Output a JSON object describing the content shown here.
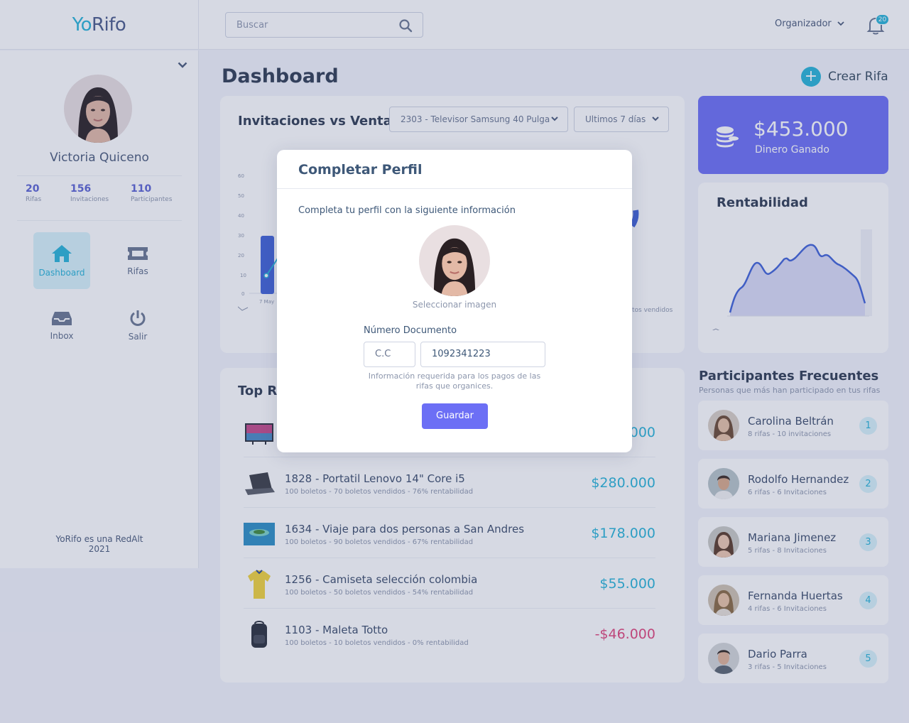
{
  "brand": {
    "logo_yo": "Yo",
    "logo_rifo": "Rifo"
  },
  "search": {
    "placeholder": "Buscar"
  },
  "header": {
    "role": "Organizador",
    "notifications": "20"
  },
  "user": {
    "name": "Victoria Quiceno",
    "stats": [
      {
        "value": "20",
        "label": "Rifas"
      },
      {
        "value": "156",
        "label": "Invitaciones"
      },
      {
        "value": "110",
        "label": "Participantes"
      }
    ]
  },
  "nav": {
    "dashboard": "Dashboard",
    "rifas": "Rifas",
    "inbox": "Inbox",
    "salir": "Salir"
  },
  "footer": {
    "line1": "YoRifo es una RedAlt",
    "line2": "2021"
  },
  "main": {
    "title": "Dashboard",
    "create_label": "Crear Rifa",
    "chart_card": {
      "title": "Invitaciones vs Ventas",
      "raffle_select": "2303 - Televisor Samsung 40 Pulga",
      "period_select": "Ultimos 7 días",
      "bar_label": "7 May",
      "side_label": "tos vendidos"
    },
    "earnings": {
      "amount": "$453.000",
      "label": "Dinero Ganado"
    },
    "rentabilidad": {
      "title": "Rentabilidad"
    },
    "top_rifas": {
      "title": "Top Ri",
      "rows": [
        {
          "title": "",
          "subtitle": "",
          "amount": "000",
          "icon": "tv-icon"
        },
        {
          "title": "1828 -  Portatil Lenovo 14\" Core i5",
          "subtitle": "100 boletos - 70 boletos vendidos - 76% rentabilidad",
          "amount": "$280.000",
          "icon": "laptop-icon"
        },
        {
          "title": "1634 -  Viaje para dos personas a San Andres",
          "subtitle": "100 boletos - 90 boletos vendidos - 67% rentabilidad",
          "amount": "$178.000",
          "icon": "beach-icon"
        },
        {
          "title": "1256 -  Camiseta selección colombia",
          "subtitle": "100 boletos - 50 boletos vendidos - 54% rentabilidad",
          "amount": "$55.000",
          "icon": "shirt-icon"
        },
        {
          "title": "1103 -  Maleta Totto",
          "subtitle": "100 boletos - 10 boletos vendidos - 0% rentabilidad",
          "amount": "-$46.000",
          "icon": "backpack-icon"
        }
      ]
    },
    "participants": {
      "title": "Participantes Frecuentes",
      "subtitle": "Personas que más han participado en tus rifas",
      "items": [
        {
          "name": "Carolina Beltrán",
          "detail": "8 rifas - 10 invitaciones",
          "rank": "1"
        },
        {
          "name": "Rodolfo Hernandez",
          "detail": "6 rifas - 6 Invitaciones",
          "rank": "2"
        },
        {
          "name": "Mariana Jimenez",
          "detail": "5 rifas - 8 Invitaciones",
          "rank": "3"
        },
        {
          "name": "Fernanda Huertas",
          "detail": "4 rifas - 6 Invitaciones",
          "rank": "4"
        },
        {
          "name": "Dario Parra",
          "detail": "3 rifas - 5 Invitaciones",
          "rank": "5"
        }
      ]
    }
  },
  "modal": {
    "title": "Completar Perfil",
    "description": "Completa tu perfil con la siguiente información",
    "select_image": "Seleccionar imagen",
    "doc_label": "Número Documento",
    "doc_type": "C.C",
    "doc_number": "1092341223",
    "help": "Información requerida para los pagos de las rifas que organices.",
    "save": "Guardar"
  },
  "colors": {
    "accent": "#27b4d8",
    "primary": "#6c6ff5",
    "negative": "#e0447a"
  }
}
